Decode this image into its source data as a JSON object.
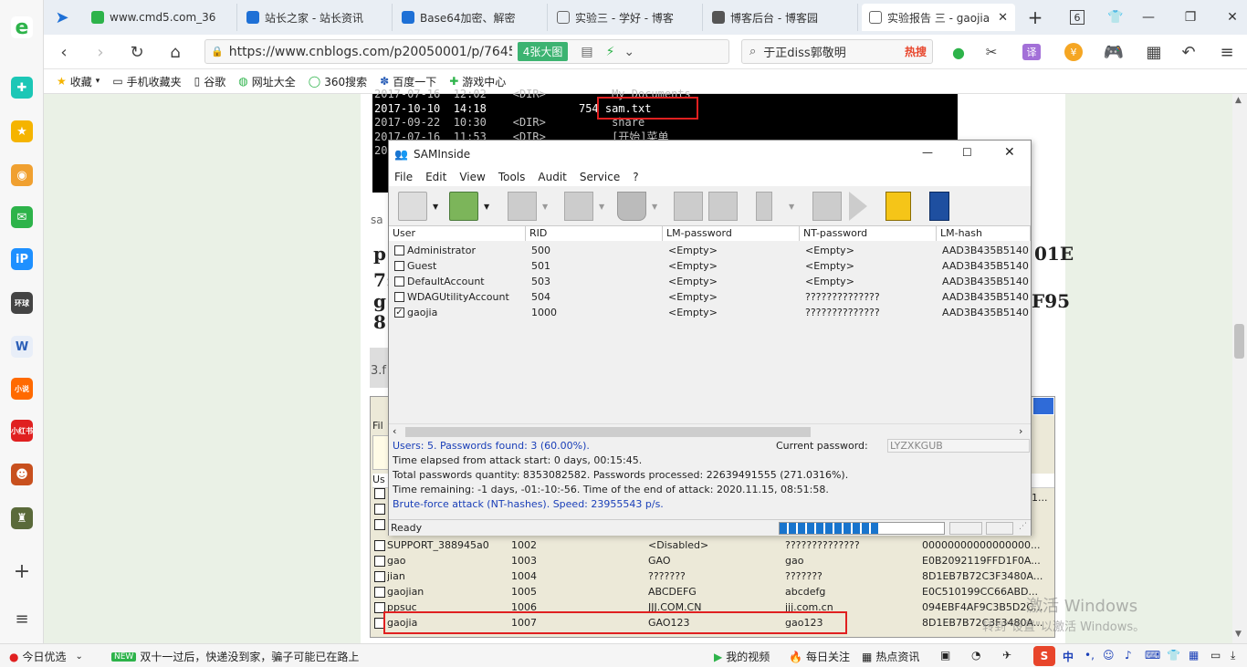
{
  "tabs": [
    {
      "title": "www.cmd5.com_36"
    },
    {
      "title": "站长之家 - 站长资讯"
    },
    {
      "title": "Base64加密、解密"
    },
    {
      "title": "实验三 - 学好 - 博客"
    },
    {
      "title": "博客后台 - 博客园"
    },
    {
      "title": "实验报告 三 - gaojia"
    }
  ],
  "tab_count": "6",
  "address": {
    "url": "https://www.cnblogs.com/p20050001/p/76457",
    "images_button": "4张大图"
  },
  "search": {
    "text": "于正diss郭敬明",
    "badge": "热搜"
  },
  "bookmarks": [
    "收藏",
    "手机收藏夹",
    "谷歌",
    "网址大全",
    "360搜索",
    "百度一下",
    "游戏中心"
  ],
  "terminal": {
    "lines": [
      "2017-07-16  12:02    <DIR>          My Documents",
      "2017-10-10  14:18              754 sam.txt",
      "2017-09-22  10:30    <DIR>          share",
      "2017-07-16  11:53    <DIR>          [开始]菜单",
      "20"
    ]
  },
  "article_fragments": {
    "sa": "sa",
    "line1_left": "p",
    "line1_right": "01E",
    "line2": "7:",
    "line3_left": "g",
    "line3_right": "F95",
    "line4": "8",
    "section": "3.f"
  },
  "window": {
    "title": "SAMInside",
    "menu": [
      "File",
      "Edit",
      "View",
      "Tools",
      "Audit",
      "Service",
      "?"
    ],
    "columns": [
      "User",
      "RID",
      "LM-password",
      "NT-password",
      "LM-hash"
    ],
    "rows": [
      {
        "user": "Administrator",
        "rid": "500",
        "lm": "<Empty>",
        "nt": "<Empty>",
        "hash": "AAD3B435B5140",
        "checked": false
      },
      {
        "user": "Guest",
        "rid": "501",
        "lm": "<Empty>",
        "nt": "<Empty>",
        "hash": "AAD3B435B5140",
        "checked": false
      },
      {
        "user": "DefaultAccount",
        "rid": "503",
        "lm": "<Empty>",
        "nt": "<Empty>",
        "hash": "AAD3B435B5140",
        "checked": false
      },
      {
        "user": "WDAGUtilityAccount",
        "rid": "504",
        "lm": "<Empty>",
        "nt": "??????????????",
        "hash": "AAD3B435B5140",
        "checked": false
      },
      {
        "user": "gaojia",
        "rid": "1000",
        "lm": "<Empty>",
        "nt": "??????????????",
        "hash": "AAD3B435B5140",
        "checked": true
      }
    ],
    "log": {
      "users_line": "Users: 5. Passwords found: 3 (60.00%).",
      "current_label": "Current password:",
      "current_value": "LYZXKGUB",
      "elapsed": "Time elapsed from attack start: 0 days, 00:15:45.",
      "total": "Total passwords quantity: 8353082582. Passwords processed: 22639491555 (271.0316%).",
      "remaining": "Time remaining: -1 days, -01:-10:-56. Time of the end of attack: 2020.11.15, 08:51:58.",
      "attack": "Brute-force attack (NT-hashes). Speed: 23955543 p/s."
    },
    "status": "Ready",
    "progress": 0.6
  },
  "sam2": {
    "menu_fragment": "Fil",
    "header_fragment": "Us",
    "hash_fragment": "1...",
    "rows": [
      {
        "user": "SUPPORT_388945a0",
        "rid": "1002",
        "lm": "<Disabled>",
        "nt": "??????????????",
        "hash": "00000000000000000..."
      },
      {
        "user": "gao",
        "rid": "1003",
        "lm": "GAO",
        "nt": "gao",
        "hash": "E0B2092119FFD1F0A..."
      },
      {
        "user": "jian",
        "rid": "1004",
        "lm": "???????",
        "nt": "???????",
        "hash": "8D1EB7B72C3F3480A..."
      },
      {
        "user": "gaojian",
        "rid": "1005",
        "lm": "ABCDEFG",
        "nt": "abcdefg",
        "hash": "E0C510199CC66ABD..."
      },
      {
        "user": "ppsuc",
        "rid": "1006",
        "lm": "JJJ.COM.CN",
        "nt": "jjj.com.cn",
        "hash": "094EBF4AF9C3B5D2C..."
      },
      {
        "user": "gaojia",
        "rid": "1007",
        "lm": "GAO123",
        "nt": "gao123",
        "hash": "8D1EB7B72C3F3480A..."
      }
    ]
  },
  "watermark": {
    "line1": "激活 Windows",
    "line2": "转到\"设置\"以激活 Windows。"
  },
  "bottom": {
    "left": "今日优选",
    "new_badge": "NEW",
    "news": "双十一过后，快递没到家，骗子可能已在路上",
    "items": [
      "我的视频",
      "每日关注",
      "热点资讯"
    ],
    "ime": "中"
  },
  "colors": {
    "accent_green": "#3cb371",
    "red_box": "#e02020",
    "progress_blue": "#1874cd",
    "blue_text": "#1a3fb8"
  }
}
